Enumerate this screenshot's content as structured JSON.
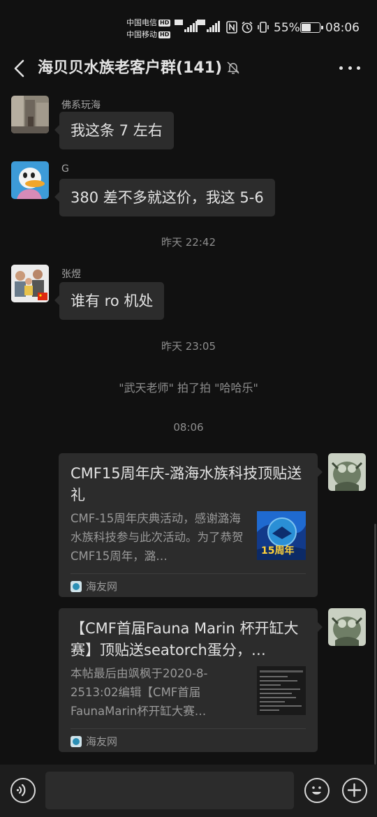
{
  "status_bar": {
    "carrier1": "中国电信",
    "carrier2": "中国移动",
    "hd": "HD",
    "net1": "4G",
    "net2": "5G",
    "battery_percent": "55%",
    "battery_level": 0.55,
    "time": "08:06",
    "icons": [
      "nfc-icon",
      "alarm-icon",
      "vibrate-icon"
    ]
  },
  "header": {
    "title": "海贝贝水族老客户群(141)",
    "back_icon": "back-arrow-icon",
    "mute_icon": "mute-bell-icon",
    "more_icon": "more-icon"
  },
  "messages": [
    {
      "sender": "佛系玩海",
      "text": "我这条 7 左右"
    },
    {
      "sender": "G",
      "text": "380 差不多就这价，我这 5-6"
    },
    {
      "sender": "张煜",
      "text": "谁有 ro 机处"
    }
  ],
  "timestamps": [
    "昨天 22:42",
    "昨天 23:05",
    "08:06"
  ],
  "system_notice": "\"武天老师\" 拍了拍 \"哈哈乐\"",
  "link_cards": [
    {
      "title": "CMF15周年庆-潞海水族科技顶贴送礼",
      "desc": "CMF-15周年庆典活动，感谢潞海水族科技参与此次活动。为了恭贺CMF15周年，潞…",
      "thumb_text": "15周年",
      "source": "海友网"
    },
    {
      "title": "【CMF首届Fauna Marin 杯开缸大赛】顶贴送seatorch蛋分，…",
      "desc": "本帖最后由飒枫于2020-8-2513:02编辑【CMF首届FaunaMarin杯开缸大赛…",
      "source": "海友网"
    }
  ],
  "input_bar": {
    "voice_icon": "voice-icon",
    "emoji_icon": "emoji-icon",
    "plus_icon": "plus-icon",
    "placeholder": ""
  },
  "colors": {
    "background": "#111111",
    "bubble": "#2c2c2c",
    "input_bar": "#1d1d1d",
    "text": "#e3e3e3",
    "muted": "#8e8e8e"
  }
}
